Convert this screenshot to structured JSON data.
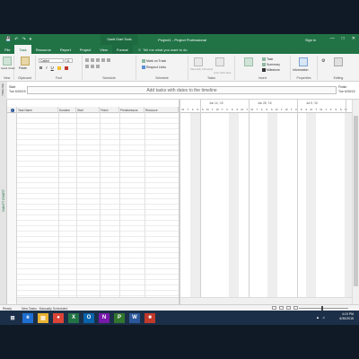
{
  "title_bar": {
    "qat": [
      "💾",
      "↶",
      "↷",
      "▾"
    ],
    "context_group": "Gantt Chart Tools",
    "app_title": "Project1 - Project Professional",
    "sign_in": "Sign in",
    "controls": [
      "—",
      "□",
      "✕"
    ]
  },
  "tabs": [
    {
      "label": "File",
      "active": false
    },
    {
      "label": "Task",
      "active": true
    },
    {
      "label": "Resource",
      "active": false
    },
    {
      "label": "Report",
      "active": false
    },
    {
      "label": "Project",
      "active": false
    },
    {
      "label": "View",
      "active": false
    },
    {
      "label": "Format",
      "active": false,
      "contextual": true
    }
  ],
  "tell_me": "Tell me what you want to do",
  "ribbon": {
    "view": {
      "button": "Gantt Chart",
      "label": "View"
    },
    "clipboard": {
      "paste": "Paste",
      "label": "Clipboard"
    },
    "font": {
      "family": "Calibri",
      "size": "11",
      "label": "Font",
      "buttons": [
        "B",
        "I",
        "U"
      ]
    },
    "schedule": {
      "label": "Schedule",
      "mark_on_track": "Mark on Track",
      "respect_links": "Respect Links"
    },
    "tasks": {
      "manually": "Manually Schedule",
      "auto": "Auto Schedule",
      "label": "Tasks"
    },
    "insert": {
      "task": "Task",
      "summary": "Summary",
      "milestone": "Milestone",
      "label": "Insert"
    },
    "properties": {
      "information": "Information",
      "label": "Properties"
    },
    "editing": {
      "label": "Editing"
    }
  },
  "timeline": {
    "vtab": "TIMELINE",
    "start_label": "Start",
    "start_date": "Tue 6/30/15",
    "finish_label": "Finish",
    "finish_date": "Tue 6/30/15",
    "placeholder": "Add tasks with dates to the timeline"
  },
  "gantt": {
    "vtab": "GANTT CHART",
    "columns": [
      "Task Name",
      "Duration",
      "Start",
      "Finish",
      "Predecessors",
      "Resource"
    ],
    "weeks": [
      "Jun 14, '15",
      "Jun 28, '15",
      "Jul 5, '15"
    ],
    "days": [
      "W",
      "T",
      "F",
      "S",
      "S",
      "M",
      "T",
      "W",
      "T",
      "F",
      "S",
      "S",
      "M",
      "T",
      "W",
      "T",
      "F",
      "S",
      "S",
      "M",
      "T",
      "W",
      "T",
      "F",
      "S",
      "S",
      "M",
      "T",
      "W",
      "T",
      "F",
      "S",
      "S",
      "M"
    ]
  },
  "status": {
    "ready": "Ready",
    "new_tasks": "New Tasks : Manually Scheduled"
  },
  "taskbar": {
    "apps": [
      {
        "name": "edge",
        "glyph": "e",
        "color": "#1f6fd0"
      },
      {
        "name": "explorer",
        "glyph": "▤",
        "color": "#e8b232"
      },
      {
        "name": "chrome",
        "glyph": "●",
        "color": "#db4437"
      },
      {
        "name": "excel",
        "glyph": "X",
        "color": "#217346"
      },
      {
        "name": "outlook",
        "glyph": "O",
        "color": "#0a64ad"
      },
      {
        "name": "onenote",
        "glyph": "N",
        "color": "#7719aa"
      },
      {
        "name": "project",
        "glyph": "P",
        "color": "#31752f"
      },
      {
        "name": "word",
        "glyph": "W",
        "color": "#2b579a"
      },
      {
        "name": "paint",
        "glyph": "■",
        "color": "#c0392b"
      }
    ],
    "time": "4:19 PM",
    "date": "6/30/2015"
  }
}
